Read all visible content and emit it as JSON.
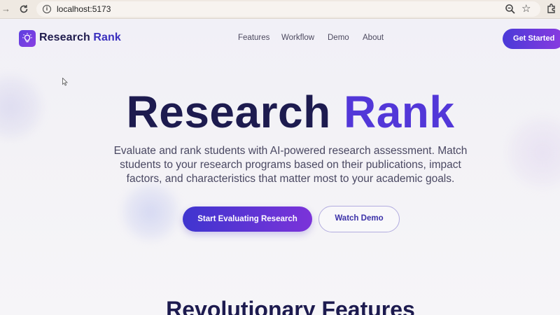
{
  "browser": {
    "url": "localhost:5173",
    "back_icon": "back-arrow-icon",
    "reload_icon": "reload-icon"
  },
  "header": {
    "logo_icon": "lightbulb-icon",
    "brand_part1": "Research",
    "brand_part2": "Rank",
    "nav": [
      {
        "label": "Features"
      },
      {
        "label": "Workflow"
      },
      {
        "label": "Demo"
      },
      {
        "label": "About"
      }
    ],
    "cta_label": "Get Started"
  },
  "hero": {
    "title_part1": "Research",
    "title_part2": "Rank",
    "subtitle_line1": "Evaluate and rank students with AI-powered research assessment. Match",
    "subtitle_line2": "students to your research programs based on their publications, impact",
    "subtitle_line3": "factors, and characteristics that matter most to your academic goals.",
    "primary_label": "Start Evaluating Research",
    "secondary_label": "Watch Demo"
  },
  "features": {
    "title": "Revolutionary Features"
  },
  "colors": {
    "brand_dark": "#1d1b4f",
    "brand_accent": "#5237d8",
    "gradient_start": "#3f35cf",
    "gradient_end": "#7b33d9"
  }
}
